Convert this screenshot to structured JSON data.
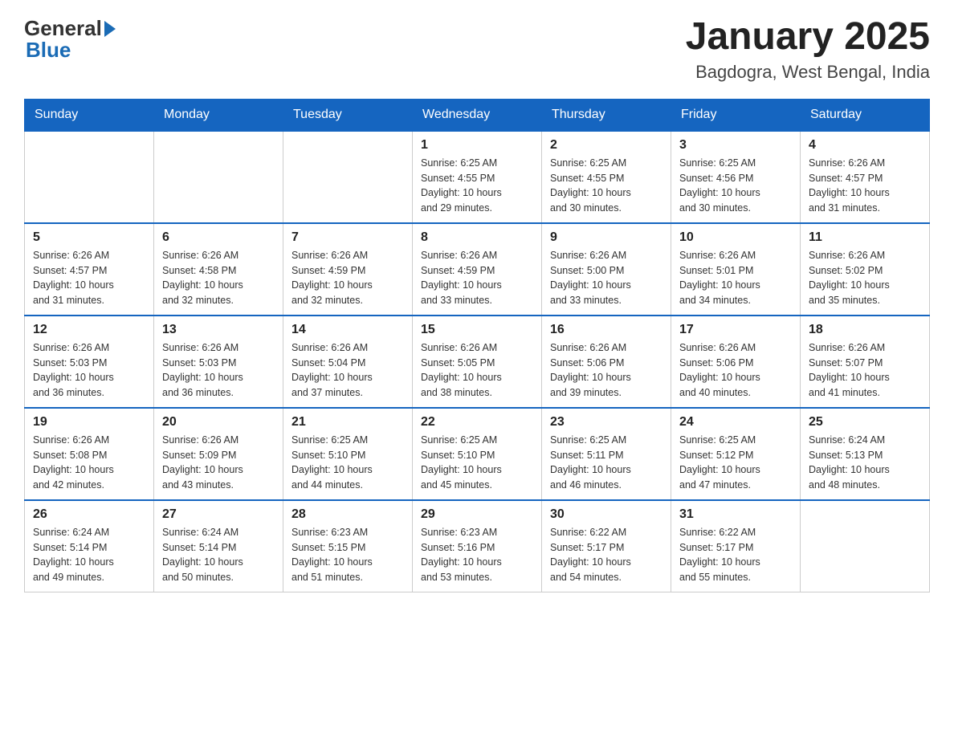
{
  "header": {
    "logo": {
      "general": "General",
      "arrow": "▶",
      "blue": "Blue"
    },
    "title": "January 2025",
    "subtitle": "Bagdogra, West Bengal, India"
  },
  "calendar": {
    "days_of_week": [
      "Sunday",
      "Monday",
      "Tuesday",
      "Wednesday",
      "Thursday",
      "Friday",
      "Saturday"
    ],
    "weeks": [
      [
        {
          "day": "",
          "info": ""
        },
        {
          "day": "",
          "info": ""
        },
        {
          "day": "",
          "info": ""
        },
        {
          "day": "1",
          "info": "Sunrise: 6:25 AM\nSunset: 4:55 PM\nDaylight: 10 hours\nand 29 minutes."
        },
        {
          "day": "2",
          "info": "Sunrise: 6:25 AM\nSunset: 4:55 PM\nDaylight: 10 hours\nand 30 minutes."
        },
        {
          "day": "3",
          "info": "Sunrise: 6:25 AM\nSunset: 4:56 PM\nDaylight: 10 hours\nand 30 minutes."
        },
        {
          "day": "4",
          "info": "Sunrise: 6:26 AM\nSunset: 4:57 PM\nDaylight: 10 hours\nand 31 minutes."
        }
      ],
      [
        {
          "day": "5",
          "info": "Sunrise: 6:26 AM\nSunset: 4:57 PM\nDaylight: 10 hours\nand 31 minutes."
        },
        {
          "day": "6",
          "info": "Sunrise: 6:26 AM\nSunset: 4:58 PM\nDaylight: 10 hours\nand 32 minutes."
        },
        {
          "day": "7",
          "info": "Sunrise: 6:26 AM\nSunset: 4:59 PM\nDaylight: 10 hours\nand 32 minutes."
        },
        {
          "day": "8",
          "info": "Sunrise: 6:26 AM\nSunset: 4:59 PM\nDaylight: 10 hours\nand 33 minutes."
        },
        {
          "day": "9",
          "info": "Sunrise: 6:26 AM\nSunset: 5:00 PM\nDaylight: 10 hours\nand 33 minutes."
        },
        {
          "day": "10",
          "info": "Sunrise: 6:26 AM\nSunset: 5:01 PM\nDaylight: 10 hours\nand 34 minutes."
        },
        {
          "day": "11",
          "info": "Sunrise: 6:26 AM\nSunset: 5:02 PM\nDaylight: 10 hours\nand 35 minutes."
        }
      ],
      [
        {
          "day": "12",
          "info": "Sunrise: 6:26 AM\nSunset: 5:03 PM\nDaylight: 10 hours\nand 36 minutes."
        },
        {
          "day": "13",
          "info": "Sunrise: 6:26 AM\nSunset: 5:03 PM\nDaylight: 10 hours\nand 36 minutes."
        },
        {
          "day": "14",
          "info": "Sunrise: 6:26 AM\nSunset: 5:04 PM\nDaylight: 10 hours\nand 37 minutes."
        },
        {
          "day": "15",
          "info": "Sunrise: 6:26 AM\nSunset: 5:05 PM\nDaylight: 10 hours\nand 38 minutes."
        },
        {
          "day": "16",
          "info": "Sunrise: 6:26 AM\nSunset: 5:06 PM\nDaylight: 10 hours\nand 39 minutes."
        },
        {
          "day": "17",
          "info": "Sunrise: 6:26 AM\nSunset: 5:06 PM\nDaylight: 10 hours\nand 40 minutes."
        },
        {
          "day": "18",
          "info": "Sunrise: 6:26 AM\nSunset: 5:07 PM\nDaylight: 10 hours\nand 41 minutes."
        }
      ],
      [
        {
          "day": "19",
          "info": "Sunrise: 6:26 AM\nSunset: 5:08 PM\nDaylight: 10 hours\nand 42 minutes."
        },
        {
          "day": "20",
          "info": "Sunrise: 6:26 AM\nSunset: 5:09 PM\nDaylight: 10 hours\nand 43 minutes."
        },
        {
          "day": "21",
          "info": "Sunrise: 6:25 AM\nSunset: 5:10 PM\nDaylight: 10 hours\nand 44 minutes."
        },
        {
          "day": "22",
          "info": "Sunrise: 6:25 AM\nSunset: 5:10 PM\nDaylight: 10 hours\nand 45 minutes."
        },
        {
          "day": "23",
          "info": "Sunrise: 6:25 AM\nSunset: 5:11 PM\nDaylight: 10 hours\nand 46 minutes."
        },
        {
          "day": "24",
          "info": "Sunrise: 6:25 AM\nSunset: 5:12 PM\nDaylight: 10 hours\nand 47 minutes."
        },
        {
          "day": "25",
          "info": "Sunrise: 6:24 AM\nSunset: 5:13 PM\nDaylight: 10 hours\nand 48 minutes."
        }
      ],
      [
        {
          "day": "26",
          "info": "Sunrise: 6:24 AM\nSunset: 5:14 PM\nDaylight: 10 hours\nand 49 minutes."
        },
        {
          "day": "27",
          "info": "Sunrise: 6:24 AM\nSunset: 5:14 PM\nDaylight: 10 hours\nand 50 minutes."
        },
        {
          "day": "28",
          "info": "Sunrise: 6:23 AM\nSunset: 5:15 PM\nDaylight: 10 hours\nand 51 minutes."
        },
        {
          "day": "29",
          "info": "Sunrise: 6:23 AM\nSunset: 5:16 PM\nDaylight: 10 hours\nand 53 minutes."
        },
        {
          "day": "30",
          "info": "Sunrise: 6:22 AM\nSunset: 5:17 PM\nDaylight: 10 hours\nand 54 minutes."
        },
        {
          "day": "31",
          "info": "Sunrise: 6:22 AM\nSunset: 5:17 PM\nDaylight: 10 hours\nand 55 minutes."
        },
        {
          "day": "",
          "info": ""
        }
      ]
    ]
  }
}
